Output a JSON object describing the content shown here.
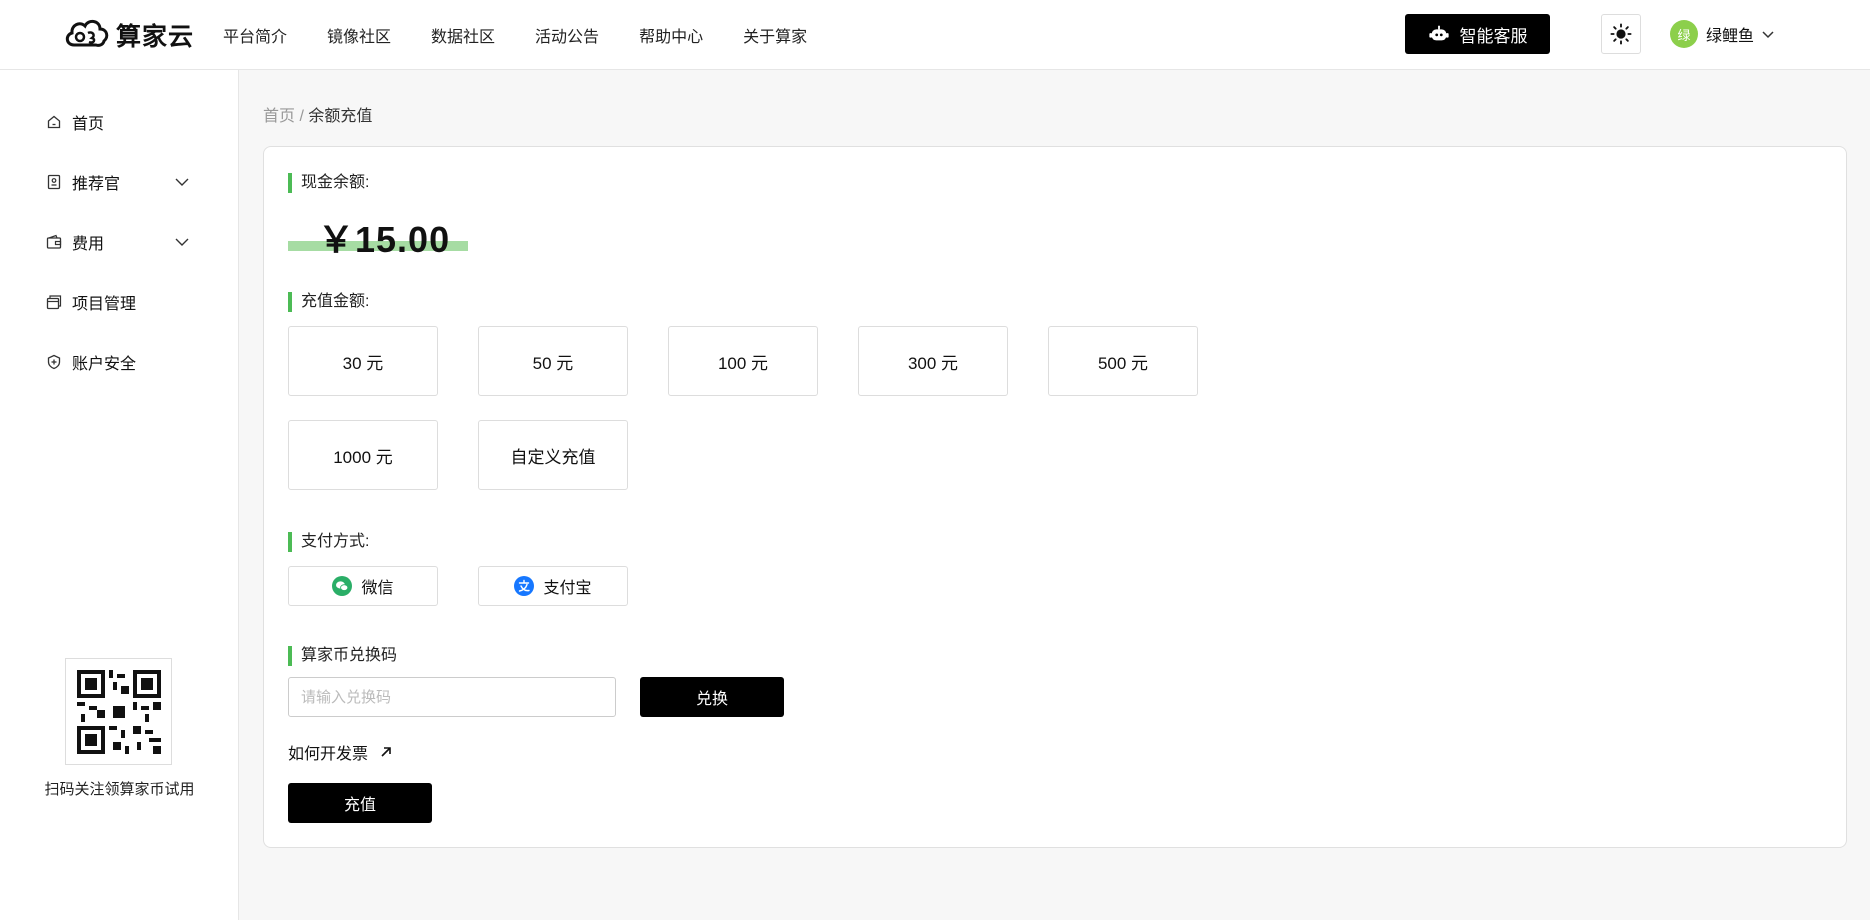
{
  "brand": {
    "name": "算家云"
  },
  "nav": [
    "平台简介",
    "镜像社区",
    "数据社区",
    "活动公告",
    "帮助中心",
    "关于算家"
  ],
  "header": {
    "service_label": "智能客服",
    "avatar_text": "绿",
    "username": "绿鲤鱼"
  },
  "sidebar": {
    "items": [
      {
        "label": "首页",
        "icon": "home-icon"
      },
      {
        "label": "推荐官",
        "icon": "badge-icon"
      },
      {
        "label": "费用",
        "icon": "wallet-icon"
      },
      {
        "label": "项目管理",
        "icon": "folder-icon"
      },
      {
        "label": "账户安全",
        "icon": "shield-icon"
      }
    ],
    "qr_caption": "扫码关注领算家币试用"
  },
  "breadcrumb": {
    "home": "首页",
    "separator": " / ",
    "current": "余额充值"
  },
  "balance": {
    "title": "现金余额:",
    "value": "￥15.00"
  },
  "recharge": {
    "title": "充值金额:",
    "options": [
      "30 元",
      "50 元",
      "100 元",
      "300 元",
      "500 元",
      "1000 元",
      "自定义充值"
    ]
  },
  "payment": {
    "title": "支付方式:",
    "methods": [
      {
        "label": "微信",
        "icon": "wechat-icon",
        "color": "#2aae67"
      },
      {
        "label": "支付宝",
        "icon": "alipay-icon",
        "color": "#1677ff"
      }
    ]
  },
  "redeem": {
    "title": "算家币兑换码",
    "placeholder": "请输入兑换码",
    "value": "",
    "button": "兑换"
  },
  "invoice_link": "如何开发票",
  "submit_label": "充值",
  "colors": {
    "accent": "#4cbb55",
    "balance_highlight": "#a6dca3",
    "primary": "#000000"
  }
}
